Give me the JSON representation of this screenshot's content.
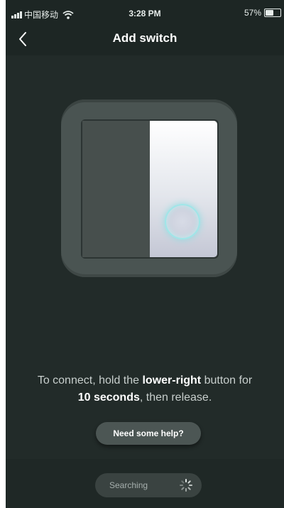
{
  "status_bar": {
    "carrier": "中国移动",
    "time": "3:28 PM",
    "battery": "57%",
    "battery_level": 0.57,
    "icons": [
      "signal-icon",
      "wifi-icon",
      "battery-icon"
    ]
  },
  "nav": {
    "title": "Add switch",
    "back_icon": "chevron-left-icon"
  },
  "instruction": {
    "part1": "To connect, hold the ",
    "bold1": "lower-right",
    "part2": " button for",
    "bold2": "10 seconds",
    "part3": ", then release."
  },
  "help_button": {
    "label": "Need some help?"
  },
  "search": {
    "label": "Searching",
    "icon": "spinner-icon"
  },
  "colors": {
    "background": "#222b29",
    "bar": "#1d2624",
    "accent_glow": "#9fe6e8"
  }
}
